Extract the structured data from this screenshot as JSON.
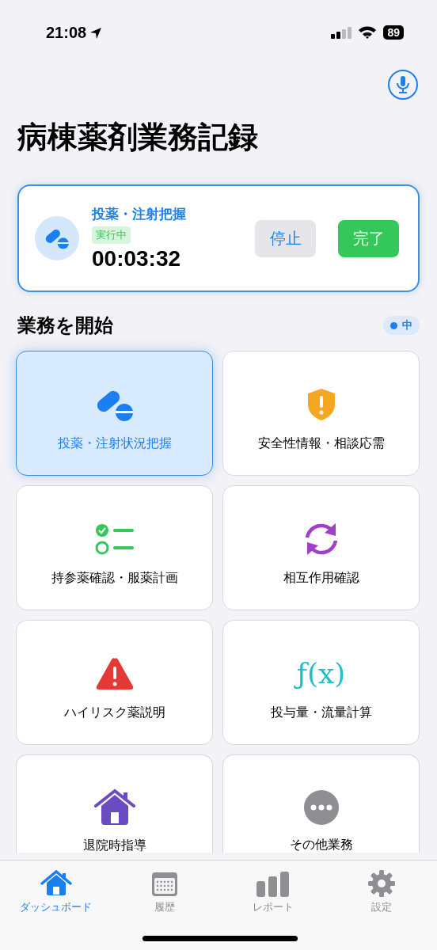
{
  "status_bar": {
    "time": "21:08",
    "battery": "89"
  },
  "header": {
    "title": "病棟薬剤業務記録"
  },
  "active_task": {
    "title": "投薬・注射把握",
    "status": "実行中",
    "elapsed": "00:03:32",
    "buttons": [
      {
        "label": "停止",
        "kind": "stop"
      },
      {
        "label": "完了",
        "kind": "done"
      }
    ]
  },
  "section": {
    "title": "業務を開始",
    "badge": "中"
  },
  "tasks": [
    {
      "label": "投薬・注射状況把握",
      "kind": "pills",
      "color": "#1a7ff0",
      "selected": true
    },
    {
      "label": "安全性情報・相談応需",
      "kind": "shield",
      "color": "#f5a623",
      "selected": false
    },
    {
      "label": "持参薬確認・服薬計画",
      "kind": "checklist",
      "color": "#34c759",
      "selected": false
    },
    {
      "label": "相互作用確認",
      "kind": "cycle",
      "color": "#a040c8",
      "selected": false
    },
    {
      "label": "ハイリスク薬説明",
      "kind": "warning",
      "color": "#e53935",
      "selected": false
    },
    {
      "label": "投与量・流量計算",
      "kind": "function",
      "color": "#20c0c8",
      "selected": false
    },
    {
      "label": "退院時指導",
      "kind": "house",
      "color": "#6a4bc4",
      "selected": false
    },
    {
      "label": "その他業務",
      "kind": "ellipsis",
      "color": "#8e8e93",
      "selected": false
    }
  ],
  "function_icon": {
    "text": "ƒ(x)"
  },
  "tab_bar": [
    {
      "label": "ダッシュボード",
      "kind": "home",
      "selected": true
    },
    {
      "label": "履歴",
      "kind": "calendar",
      "selected": false
    },
    {
      "label": "レポート",
      "kind": "chart",
      "selected": false
    },
    {
      "label": "設定",
      "kind": "gear",
      "selected": false
    }
  ]
}
